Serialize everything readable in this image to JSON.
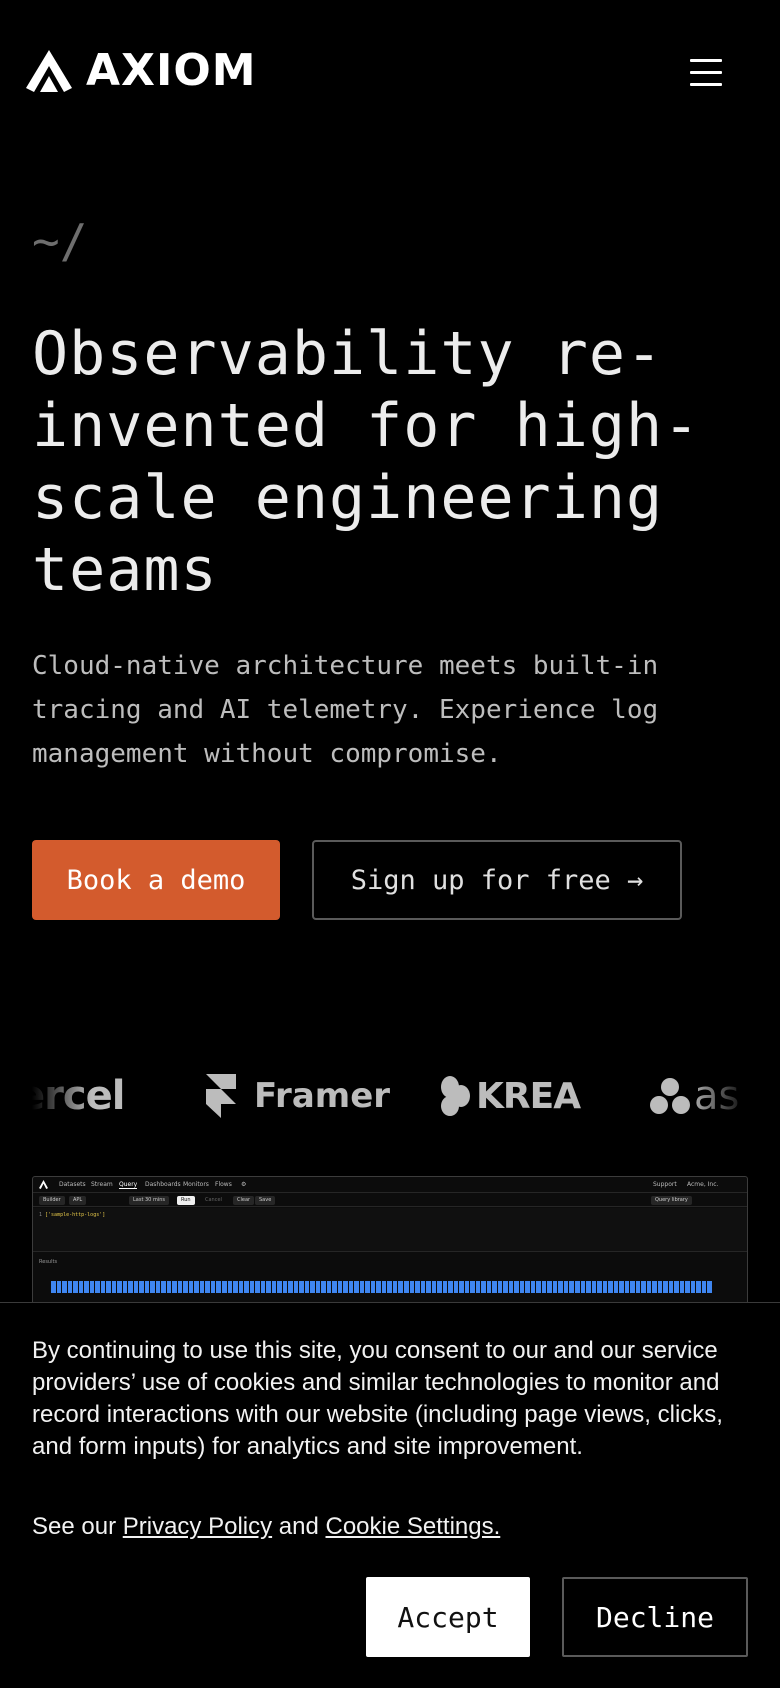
{
  "header": {
    "brand_name": "AXIOM",
    "menu_icon": "hamburger-menu-icon"
  },
  "hero": {
    "eyebrow": "~/",
    "title": "Observability re-invented for high-scale engineering teams",
    "subtitle": "Cloud-native architecture meets built-in tracing and AI telemetry. Experience log management without compromise.",
    "primary_cta": "Book a demo",
    "secondary_cta": "Sign up for free →"
  },
  "customer_logos": [
    {
      "name": "ercel",
      "icon": "vercel-wordmark"
    },
    {
      "name": "Framer",
      "icon": "framer-logo-icon"
    },
    {
      "name": "KREA",
      "icon": "krea-logo-icon"
    },
    {
      "name": "as",
      "icon": "asana-logo-icon"
    }
  ],
  "app_preview": {
    "nav_items": [
      "Datasets",
      "Stream",
      "Query",
      "Dashboards",
      "Monitors",
      "Flows"
    ],
    "nav_right": [
      "Support",
      "Acme, Inc."
    ],
    "toolbar": [
      "Builder",
      "APL",
      "Last 30 mins",
      "Run",
      "Cancel",
      "Clear",
      "Save"
    ],
    "query_library": "Query library",
    "code_line": "['sample-http-logs']",
    "results_label": "Results",
    "accent_color": "#3f86f0"
  },
  "cookie_banner": {
    "text": "By continuing to use this site, you consent to our and our service providers’ use of cookies and similar technologies to monitor and record interactions with our website (including page views, clicks, and form inputs) for analytics and site improvement.",
    "see_our": "See our",
    "privacy_policy": "Privacy Policy",
    "and": "and",
    "cookie_settings": "Cookie Settings.",
    "accept": "Accept",
    "decline": "Decline"
  },
  "colors": {
    "background": "#000000",
    "accent_orange": "#d35b2d",
    "text": "#ececec",
    "muted": "#6e6e6e"
  }
}
